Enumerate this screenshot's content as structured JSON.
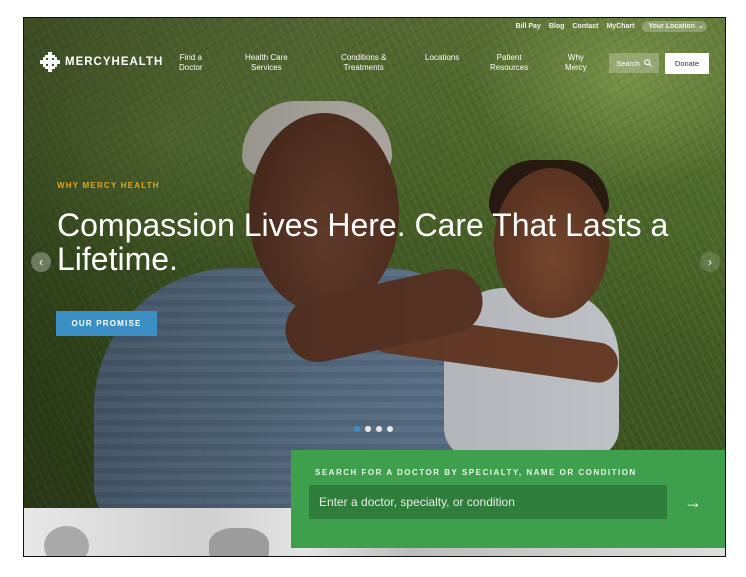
{
  "utility_nav": {
    "links": [
      "Bill Pay",
      "Blog",
      "Contact",
      "MyChart"
    ],
    "location_label": "Your Location"
  },
  "logo": {
    "text": "MERCYHEALTH"
  },
  "main_nav": {
    "items": [
      "Find a\nDoctor",
      "Health Care\nServices",
      "Conditions &\nTreatments",
      "Locations",
      "Patient\nResources",
      "Why\nMercy"
    ],
    "search_label": "Search",
    "donate_label": "Donate"
  },
  "hero": {
    "eyebrow": "WHY MERCY HEALTH",
    "headline": "Compassion Lives Here. Care That Lasts a Lifetime.",
    "cta_label": "OUR PROMISE",
    "slide_count": 4,
    "active_slide": 1
  },
  "doctor_search": {
    "label": "SEARCH FOR A DOCTOR BY SPECIALTY, NAME OR CONDITION",
    "placeholder": "Enter a doctor, specialty, or condition",
    "submit_icon": "arrow-right-icon"
  },
  "colors": {
    "accent_gold": "#e3a21a",
    "cta_blue": "#3b8fc4",
    "search_green": "#3e9f4c"
  }
}
